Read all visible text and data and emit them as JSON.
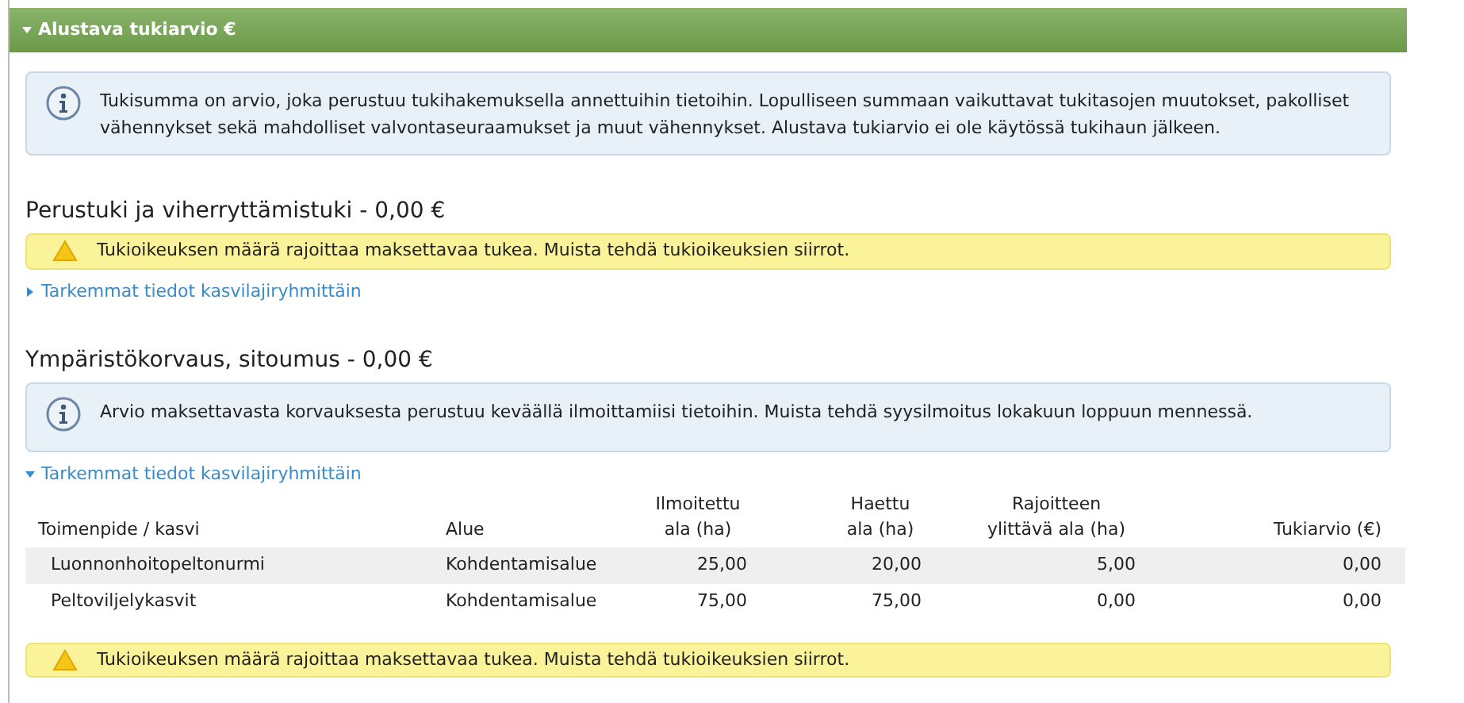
{
  "panel": {
    "title": "Alustava tukiarvio €",
    "expanded": true
  },
  "notice": "Tukisumma on arvio, joka perustuu tukihakemuksella annettuihin tietoihin. Lopulliseen summaan vaikuttavat tukitasojen muutokset, pakolliset vähennykset sekä mahdolliset valvontaseuraamukset ja muut vähennykset. Alustava tukiarvio ei ole käytössä tukihaun jälkeen.",
  "sections": [
    {
      "title": "Perustuki ja viherryttämistuki - 0,00 €",
      "alerts": [
        {
          "kind": "warning",
          "text": "Tukioikeuksen määrä rajoittaa maksettavaa tukea. Muista tehdä tukioikeuksien siirrot."
        }
      ],
      "details": {
        "label": "Tarkemmat tiedot kasvilajiryhmittäin",
        "expanded": false
      }
    },
    {
      "title": "Ympäristökorvaus, sitoumus - 0,00 €",
      "alerts": [
        {
          "kind": "info",
          "text": "Arvio maksettavasta korvauksesta perustuu keväällä ilmoittamiisi tietoihin. Muista tehdä syysilmoitus lokakuun loppuun mennessä."
        }
      ],
      "details": {
        "label": "Tarkemmat tiedot kasvilajiryhmittäin",
        "expanded": true
      },
      "table": {
        "columns": [
          "Toimenpide / kasvi",
          "Alue",
          "Ilmoitettu ala (ha)",
          "Haettu ala (ha)",
          "Rajoitteen ylittävä ala (ha)",
          "Tukiarvio (€)"
        ],
        "rows": [
          [
            "Luonnonhoitopeltonurmi",
            "Kohdentamisalue",
            "25,00",
            "20,00",
            "5,00",
            "0,00"
          ],
          [
            "Peltoviljelykasvit",
            "Kohdentamisalue",
            "75,00",
            "75,00",
            "0,00",
            "0,00"
          ]
        ]
      }
    }
  ],
  "bottom_alert": {
    "kind": "warning",
    "text": "Tukioikeuksen määrä rajoittaa maksettavaa tukea. Muista tehdä tukioikeuksien siirrot."
  }
}
